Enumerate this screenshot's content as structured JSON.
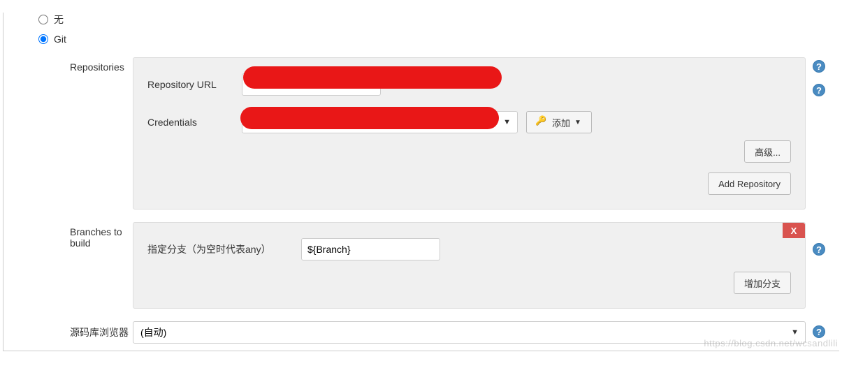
{
  "scm": {
    "none_label": "无",
    "git_label": "Git",
    "selected": "git"
  },
  "repositories": {
    "section_label": "Repositories",
    "url_label": "Repository URL",
    "url_value": "",
    "credentials_label": "Credentials",
    "credentials_value": "",
    "add_label": "添加",
    "advanced_label": "高级...",
    "add_repo_label": "Add Repository"
  },
  "branches": {
    "section_label": "Branches to build",
    "specifier_label": "指定分支（为空时代表any）",
    "specifier_value": "${Branch}",
    "add_branch_label": "增加分支"
  },
  "repo_browser": {
    "section_label": "源码库浏览器",
    "selected_label": "(自动)"
  },
  "watermark": "https://blog.csdn.net/wcsandlili"
}
